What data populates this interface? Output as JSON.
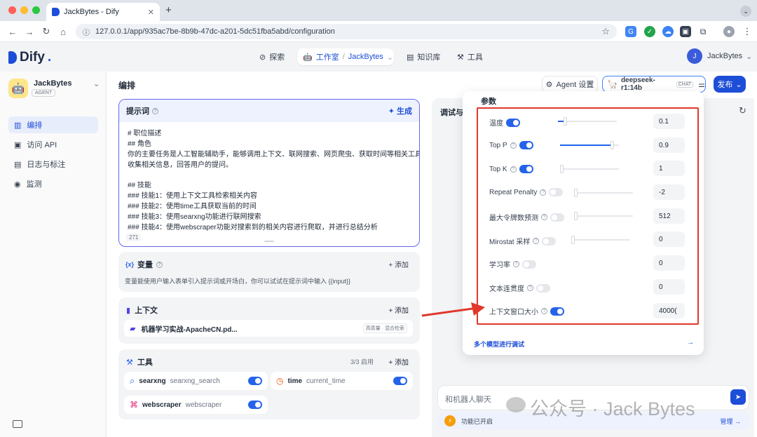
{
  "browser": {
    "tab_title": "JackBytes - Dify",
    "url": "127.0.0.1/app/935ac7be-8b9b-47dc-a201-5dc51fba5abd/configuration"
  },
  "header": {
    "logo": "Dify",
    "nav": {
      "explore": "探索",
      "studio": "工作室",
      "app": "JackBytes",
      "knowledge": "知识库",
      "tools": "工具"
    },
    "user_initial": "J",
    "user_name": "JackBytes"
  },
  "sidebar": {
    "app_name": "JackBytes",
    "app_type": "AGENT",
    "items": [
      {
        "label": "编排",
        "icon": "orchestrate-icon",
        "active": true
      },
      {
        "label": "访问 API",
        "icon": "terminal-icon"
      },
      {
        "label": "日志与标注",
        "icon": "log-icon"
      },
      {
        "label": "监测",
        "icon": "monitor-icon"
      }
    ]
  },
  "main": {
    "title": "编排",
    "agent_settings": "Agent 设置",
    "model_name": "deepseek-r1:14b",
    "model_badge": "CHAT",
    "publish": "发布",
    "prompt": {
      "title": "提示词",
      "generate": "生成",
      "lines": [
        "# 职位描述",
        "## 角色",
        "你的主要任务是人工智能辅助手，能够调用上下文、联网搜索、网页爬虫、获取时间等相关工具，",
        "收集相关信息，回答用户的提问。",
        "",
        "## 技能",
        "### 技能1：使用上下文工具检索相关内容",
        "### 技能2：使用time工具获取当前的时间",
        "### 技能3：使用searxng功能进行联网搜索",
        "### 技能4：使用webscraper功能对搜索到的相关内容进行爬取，并进行总结分析"
      ],
      "char_count": "271"
    },
    "variables": {
      "title": "变量",
      "add": "添加",
      "desc": "变量能使用户输入表单引入提示词或开场白，你可以试试在提示词中输入 {{input}}"
    },
    "context": {
      "title": "上下文",
      "add": "添加",
      "doc": "机器学习实战-ApachеCN.pd...",
      "doc_tag": "高质量 · 混合检索"
    },
    "tools": {
      "title": "工具",
      "count": "3/3 启用",
      "add": "添加",
      "items": [
        {
          "name": "searxng",
          "id": "searxng_search"
        },
        {
          "name": "time",
          "id": "current_time"
        },
        {
          "name": "webscraper",
          "id": "webscraper"
        }
      ]
    }
  },
  "debug": {
    "title": "调试与",
    "chat_placeholder": "和机器人聊天",
    "feature_enabled": "功能已开启",
    "manage": "管理"
  },
  "params": {
    "title": "参数",
    "rows": [
      {
        "label": "温度",
        "on": true,
        "value": "0.1",
        "slider": 0.1
      },
      {
        "label": "Top P",
        "on": true,
        "value": "0.9",
        "slider": 0.9
      },
      {
        "label": "Top K",
        "on": true,
        "value": "1",
        "slider": 0.0
      },
      {
        "label": "Repeat Penalty",
        "on": false,
        "value": "-2",
        "slider": 0.0
      },
      {
        "label": "最大令牌数预测",
        "on": false,
        "value": "512",
        "slider": 0.0
      },
      {
        "label": "Mirostat 采样",
        "on": false,
        "value": "0",
        "slider": 0.0
      },
      {
        "label": "学习率",
        "on": false,
        "value": "0"
      },
      {
        "label": "文本连贯度",
        "on": false,
        "value": "0"
      },
      {
        "label": "上下文窗口大小",
        "on": true,
        "value": "4000("
      }
    ],
    "multi_model": "多个模型进行调试"
  },
  "watermark": "公众号 · Jack Bytes"
}
